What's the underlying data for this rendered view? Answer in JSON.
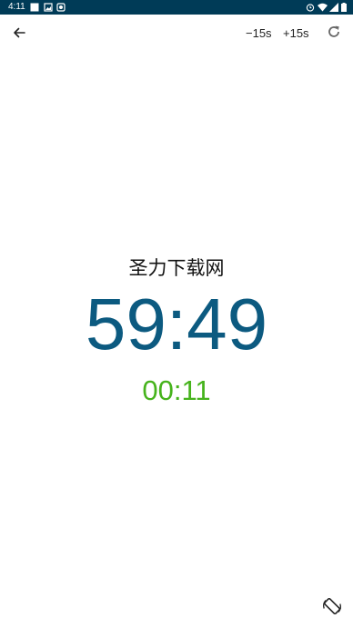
{
  "status_bar": {
    "time": "4:11",
    "left_icons": [
      "square-notification-icon",
      "image-notification-icon",
      "android-notification-icon"
    ],
    "right_icons": [
      "alarm-icon",
      "wifi-icon",
      "signal-icon",
      "battery-icon"
    ]
  },
  "app_bar": {
    "back_icon": "arrow-left-icon",
    "minus_label": "−15s",
    "plus_label": "+15s",
    "reset_icon": "refresh-icon"
  },
  "timer": {
    "title": "圣力下载网",
    "remaining": "59:49",
    "elapsed": "00:11"
  },
  "bottom": {
    "rotate_icon": "screen-rotation-icon"
  },
  "colors": {
    "status_bar": "#003b57",
    "main_time": "#0c5a80",
    "elapsed_time": "#46b31c"
  }
}
